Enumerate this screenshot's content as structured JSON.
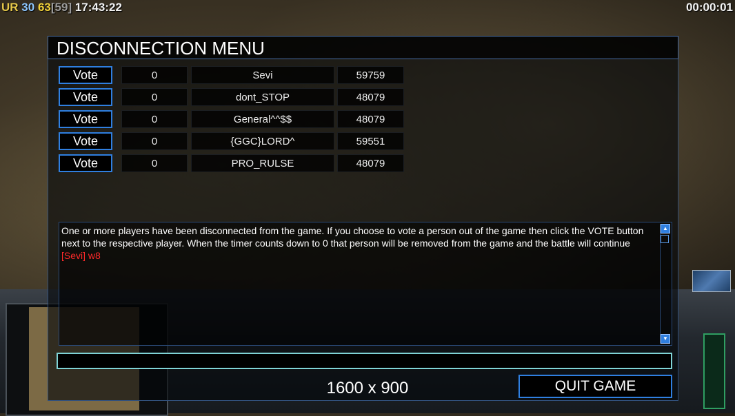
{
  "hud": {
    "ur_label": "UR",
    "fps": "30",
    "logic_rate": "63",
    "logic_target": "[59]",
    "clock": "17:43:22",
    "game_timer": "00:00:01"
  },
  "dialog": {
    "title": "DISCONNECTION MENU",
    "players": [
      {
        "vote_label": "Vote",
        "votes": "0",
        "name": "Sevi",
        "ping": "59759"
      },
      {
        "vote_label": "Vote",
        "votes": "0",
        "name": "dont_STOP",
        "ping": "48079"
      },
      {
        "vote_label": "Vote",
        "votes": "0",
        "name": "General^^$$",
        "ping": "48079"
      },
      {
        "vote_label": "Vote",
        "votes": "0",
        "name": "{GGC}LORD^",
        "ping": "59551"
      },
      {
        "vote_label": "Vote",
        "votes": "0",
        "name": "PRO_RULSE",
        "ping": "48079"
      }
    ],
    "chat": {
      "message": "One or more players have been disconnected from the game. If you choose to vote a person out of the game then click the VOTE button next to the respective player. When the timer counts down to 0 that person will be removed from the game and the battle will continue",
      "player_line": "[Sevi] w8"
    },
    "chat_input": {
      "value": "",
      "placeholder": ""
    },
    "resolution": "1600 x 900",
    "quit_label": "QUIT GAME"
  },
  "colors": {
    "accent_blue": "#2f7fe0",
    "input_border": "#7fd3d6",
    "chat_player": "#ff2a2a"
  },
  "icons": [
    "scroll-up-arrow-icon",
    "scroll-down-arrow-icon"
  ]
}
